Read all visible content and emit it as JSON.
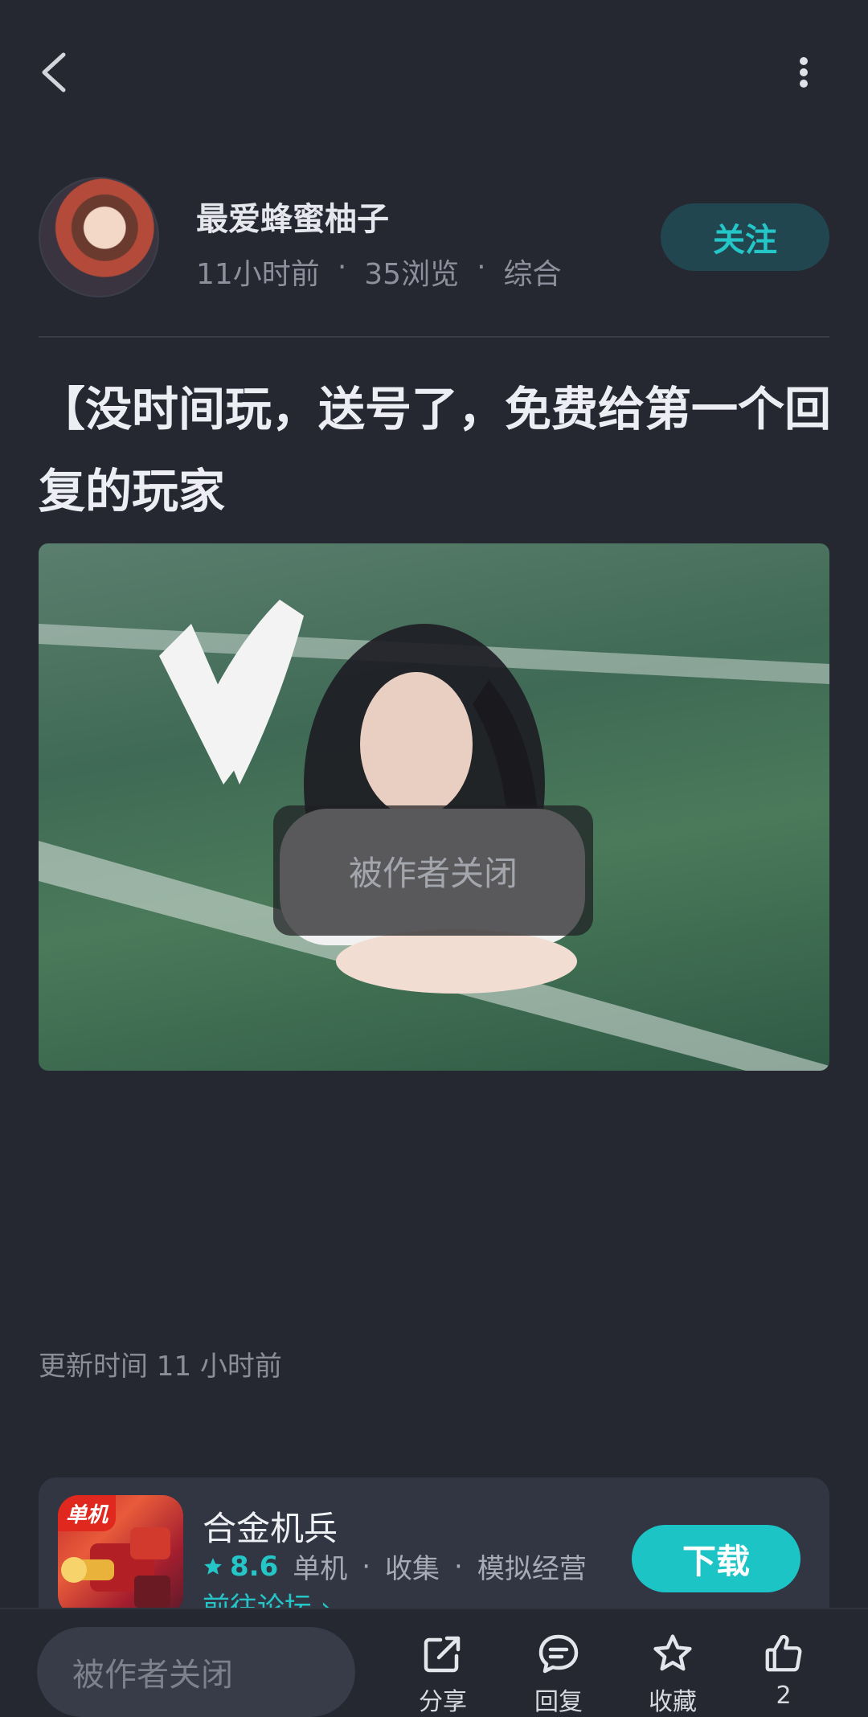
{
  "author": {
    "name": "最爱蜂蜜柚子",
    "meta": [
      "11小时前",
      "·",
      "35浏览",
      "·",
      "综合"
    ],
    "follow_label": "关注"
  },
  "post": {
    "title": "【没时间玩，送号了，免费给第一个回复的玩家",
    "image_overlay_text": "被作者关闭",
    "update_time": "更新时间 11 小时前"
  },
  "game": {
    "icon_tag": "单机",
    "name": "合金机兵",
    "rating": "8.6",
    "tags": [
      "单机",
      "·",
      "收集",
      "·",
      "模拟经营"
    ],
    "forum_link": "前往论坛 ›",
    "download_label": "下载"
  },
  "bottom": {
    "input_placeholder": "被作者关闭",
    "share_label": "分享",
    "reply_label": "回复",
    "favorite_label": "收藏",
    "like_count": "2"
  },
  "colors": {
    "background": "#252731",
    "accent": "#24c6c8"
  }
}
